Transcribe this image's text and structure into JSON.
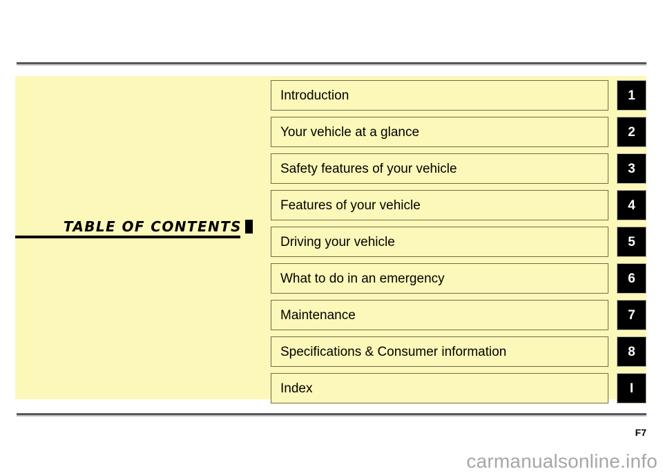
{
  "document": {
    "title": "TABLE  OF  CONTENTS",
    "page_number": "F7",
    "watermark": "carmanualsonline.info"
  },
  "colors": {
    "panel_background": "#fcf8b9",
    "row_border": "#6d6b45",
    "tab_background": "#000000",
    "tab_text": "#ffffff",
    "rule": "#58585a",
    "watermark_text": "#a6a6a6"
  },
  "toc": {
    "rows": [
      {
        "label": "Introduction",
        "tab": "1"
      },
      {
        "label": "Your vehicle at a glance",
        "tab": "2"
      },
      {
        "label": "Safety features of your vehicle",
        "tab": "3"
      },
      {
        "label": "Features of your vehicle",
        "tab": "4"
      },
      {
        "label": "Driving your vehicle",
        "tab": "5"
      },
      {
        "label": "What to do in an emergency",
        "tab": "6"
      },
      {
        "label": "Maintenance",
        "tab": "7"
      },
      {
        "label": "Specifications & Consumer information",
        "tab": "8"
      },
      {
        "label": "Index",
        "tab": "I"
      }
    ]
  }
}
